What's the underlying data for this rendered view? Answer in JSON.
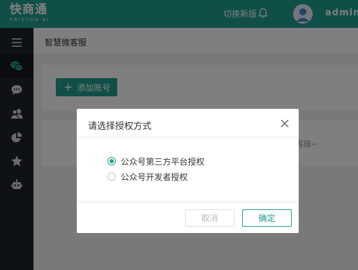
{
  "app": {
    "logo_main": "快商通",
    "logo_sub": "KRISTON AI",
    "switch_version": "切换新版",
    "username": "admin",
    "accent_color": "#1f9e8e"
  },
  "sidebar": {
    "items": [
      {
        "icon": "menu-icon"
      },
      {
        "icon": "wechat-icon",
        "active": true
      },
      {
        "icon": "chat-bubble-icon"
      },
      {
        "icon": "users-icon"
      },
      {
        "icon": "pie-chart-icon"
      },
      {
        "icon": "star-icon"
      },
      {
        "icon": "robot-icon"
      }
    ]
  },
  "page": {
    "title": "智慧微客服",
    "add_account_label": "添加账号",
    "empty_hint": "客服~"
  },
  "dialog": {
    "title": "请选择授权方式",
    "options": [
      {
        "label": "公众号第三方平台授权",
        "selected": true
      },
      {
        "label": "公众号开发者授权",
        "selected": false
      }
    ],
    "cancel_label": "取消",
    "ok_label": "确定"
  }
}
